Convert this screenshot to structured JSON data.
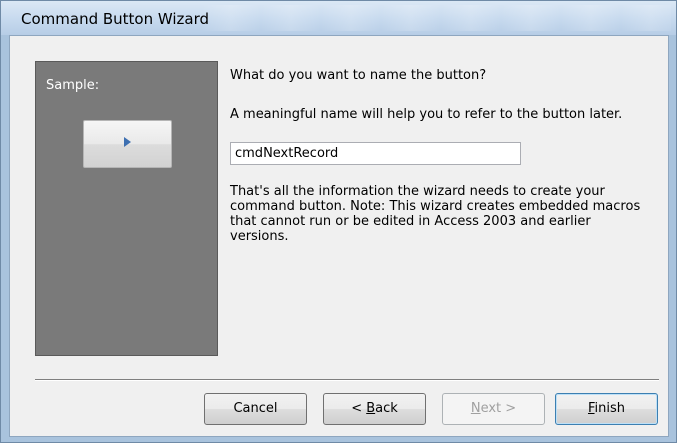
{
  "window": {
    "title": "Command Button Wizard"
  },
  "sample": {
    "label": "Sample:",
    "button_icon": "play-icon"
  },
  "main": {
    "question": "What do you want to name the button?",
    "hint": "A meaningful name will help you to refer to the button later.",
    "name_input_value": "cmdNextRecord",
    "info": "That's all the information the wizard needs to create your command button. Note: This wizard creates embedded macros that cannot run or be edited in Access 2003 and earlier versions."
  },
  "buttons": {
    "cancel": "Cancel",
    "back_prefix": "< ",
    "back_mnemonic": "B",
    "back_rest": "ack",
    "next_mnemonic": "N",
    "next_rest": "ext >",
    "finish_mnemonic": "F",
    "finish_rest": "inish"
  },
  "colors": {
    "accent": "#3d6fb1",
    "sample_bg": "#7a7a7a",
    "dialog_bg": "#f0f0f0"
  }
}
